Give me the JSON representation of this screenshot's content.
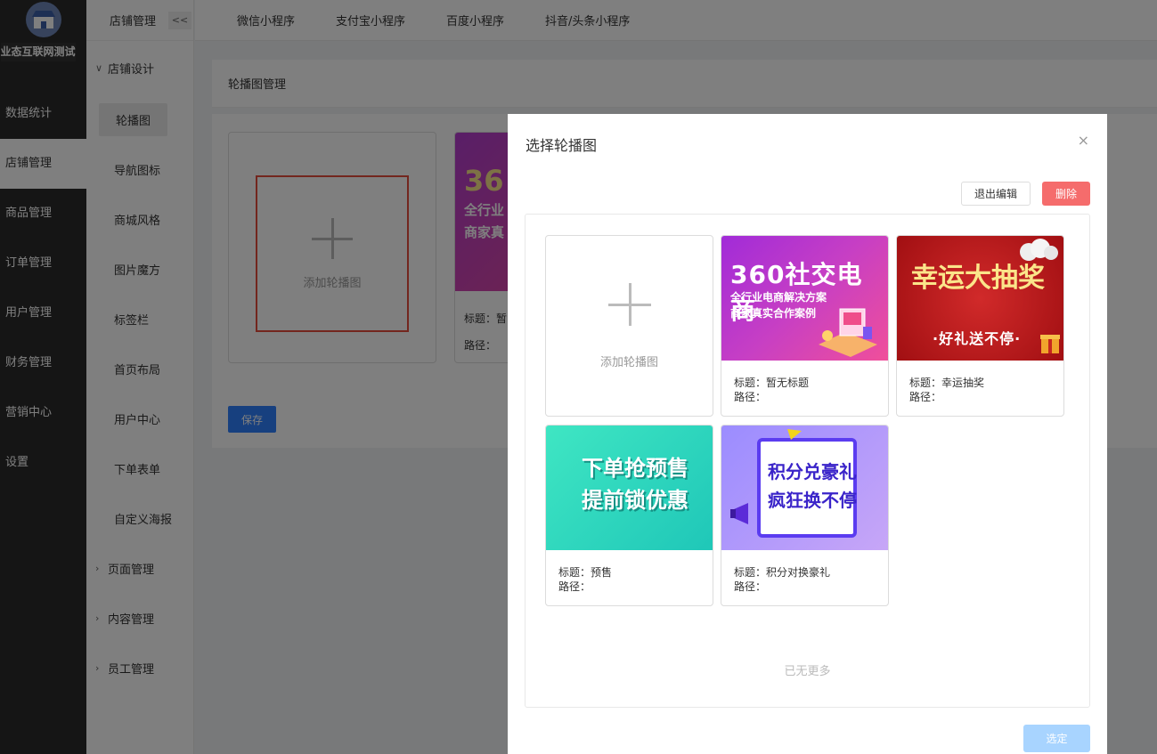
{
  "sidebar": {
    "shop_name": "业态互联网测试",
    "items": [
      {
        "label": "数据统计"
      },
      {
        "label": "店铺管理"
      },
      {
        "label": "商品管理"
      },
      {
        "label": "订单管理"
      },
      {
        "label": "用户管理"
      },
      {
        "label": "财务管理"
      },
      {
        "label": "营销中心"
      },
      {
        "label": "设置"
      }
    ],
    "active_index": 1
  },
  "subbar": {
    "header": "店铺管理",
    "collapse_label": "<<",
    "group_design": "店铺设计",
    "items": [
      {
        "label": "轮播图"
      },
      {
        "label": "导航图标"
      },
      {
        "label": "商城风格"
      },
      {
        "label": "图片魔方"
      },
      {
        "label": "标签栏"
      },
      {
        "label": "首页布局"
      },
      {
        "label": "用户中心"
      },
      {
        "label": "下单表单"
      },
      {
        "label": "自定义海报"
      }
    ],
    "groups_collapsed": [
      {
        "label": "页面管理"
      },
      {
        "label": "内容管理"
      },
      {
        "label": "员工管理"
      }
    ]
  },
  "topbar": {
    "tabs": [
      {
        "label": "微信小程序"
      },
      {
        "label": "支付宝小程序"
      },
      {
        "label": "百度小程序"
      },
      {
        "label": "抖音/头条小程序"
      }
    ]
  },
  "main": {
    "panel_title": "轮播图管理",
    "add_label": "添加轮播图",
    "bg_card": {
      "banner_big": "36",
      "banner_line1": "全行业",
      "banner_line2": "商家真",
      "title_label": "标题：暂",
      "path_label": "路径："
    },
    "save_label": "保存"
  },
  "modal": {
    "title": "选择轮播图",
    "close": "×",
    "exit_edit_label": "退出编辑",
    "delete_label": "删除",
    "add_label": "添加轮播图",
    "cards": [
      {
        "banner_title": "360社交电商",
        "banner_line1": "全行业电商解决方案",
        "banner_line2": "商家真实合作案例",
        "title_text": "标题：暂无标题",
        "path_text": "路径："
      },
      {
        "banner_title": "幸运大抽奖",
        "banner_line1": "·好礼送不停·",
        "title_text": "标题：幸运抽奖",
        "path_text": "路径："
      },
      {
        "banner_line1": "下单抢预售",
        "banner_line2": "提前锁优惠",
        "title_text": "标题：预售",
        "path_text": "路径："
      },
      {
        "banner_line1": "积分兑豪礼",
        "banner_line2": "疯狂换不停",
        "title_text": "标题：积分对换豪礼",
        "path_text": "路径："
      }
    ],
    "no_more": "已无更多",
    "confirm_label": "选定"
  }
}
